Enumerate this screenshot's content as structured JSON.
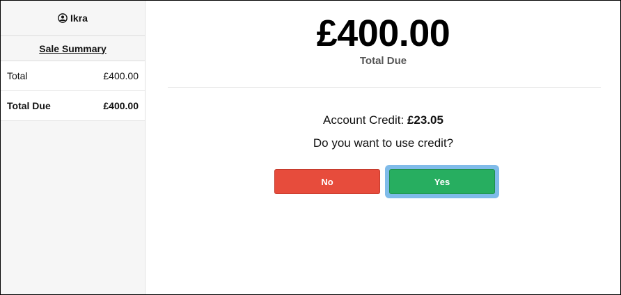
{
  "sidebar": {
    "user_name": "Ikra",
    "summary_title": "Sale Summary",
    "rows": [
      {
        "label": "Total",
        "value": "£400.00"
      },
      {
        "label": "Total Due",
        "value": "£400.00"
      }
    ]
  },
  "main": {
    "amount": "£400.00",
    "amount_label": "Total Due",
    "credit_prefix": "Account Credit: ",
    "credit_value": "£23.05",
    "question": "Do you want to use credit?",
    "no_label": "No",
    "yes_label": "Yes"
  },
  "colors": {
    "no_button": "#e74c3c",
    "yes_button": "#27ae60",
    "focus_ring": "#7fbbe9"
  }
}
